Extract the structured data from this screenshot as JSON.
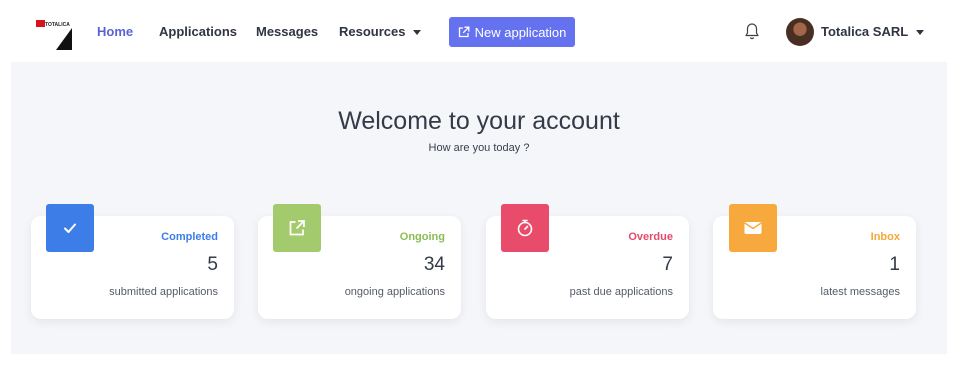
{
  "nav": {
    "logo_text": "TOTALICA",
    "links": [
      {
        "label": "Home",
        "active": true
      },
      {
        "label": "Applications",
        "active": false
      },
      {
        "label": "Messages",
        "active": false
      },
      {
        "label": "Resources",
        "active": false,
        "has_dropdown": true
      }
    ],
    "new_button_label": "New application",
    "notification_icon": "bell-icon",
    "user_name": "Totalica SARL"
  },
  "hero": {
    "title": "Welcome to your account",
    "subtitle": "How are you today ?"
  },
  "stats": [
    {
      "title": "Completed",
      "count": "5",
      "description": "submitted applications",
      "color": "#3c7de8",
      "icon": "check-icon"
    },
    {
      "title": "Ongoing",
      "count": "34",
      "description": "ongoing applications",
      "color": "#8cbd55",
      "icon": "external-link-icon"
    },
    {
      "title": "Overdue",
      "count": "7",
      "description": "past due applications",
      "color": "#e54a6b",
      "icon": "stopwatch-icon"
    },
    {
      "title": "Inbox",
      "count": "1",
      "description": "latest messages",
      "color": "#f7a737",
      "icon": "envelope-icon"
    }
  ]
}
